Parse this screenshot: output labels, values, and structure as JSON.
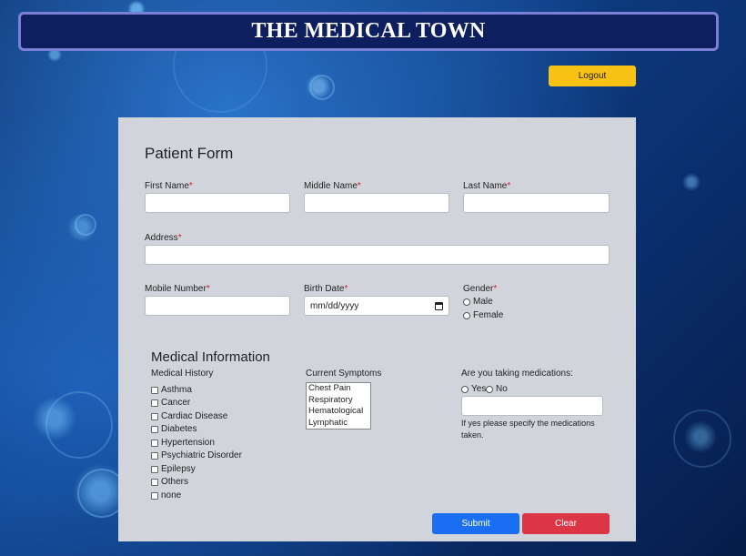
{
  "header": {
    "title": "THE MEDICAL TOWN"
  },
  "topbar": {
    "logout_label": "Logout"
  },
  "form": {
    "title": "Patient Form",
    "first_name": {
      "label": "First Name",
      "required_mark": "*",
      "value": ""
    },
    "middle_name": {
      "label": "Middle Name",
      "required_mark": "*",
      "value": ""
    },
    "last_name": {
      "label": "Last Name",
      "required_mark": "*",
      "value": ""
    },
    "address": {
      "label": "Address",
      "required_mark": "*",
      "value": ""
    },
    "mobile": {
      "label": "Mobile Number",
      "required_mark": "*",
      "value": ""
    },
    "birth_date": {
      "label": "Birth Date",
      "required_mark": "*",
      "placeholder": "mm/dd/yyyy"
    },
    "gender": {
      "label": "Gender",
      "required_mark": "*",
      "options": [
        "Male",
        "Female"
      ]
    }
  },
  "medical": {
    "title": "Medical Information",
    "history_label": "Medical History",
    "history_items": [
      "Asthma",
      "Cancer",
      "Cardiac Disease",
      "Diabetes",
      "Hypertension",
      "Psychiatric Disorder",
      "Epilepsy",
      "Others",
      "none"
    ],
    "symptoms_label": "Current Symptoms",
    "symptoms_options": [
      "Chest Pain",
      "Respiratory",
      "Hematological",
      "Lymphatic"
    ],
    "medications_label": "Are you taking medications:",
    "medications_options": [
      "Yes",
      "No"
    ],
    "medications_value": "",
    "medications_hint": "If yes please specify the medications taken."
  },
  "actions": {
    "submit_label": "Submit",
    "clear_label": "Clear"
  },
  "colors": {
    "accent_submit": "#1a6ef2",
    "accent_clear": "#dc3545",
    "logout": "#f7c213",
    "header_border": "#7b7fd6"
  }
}
